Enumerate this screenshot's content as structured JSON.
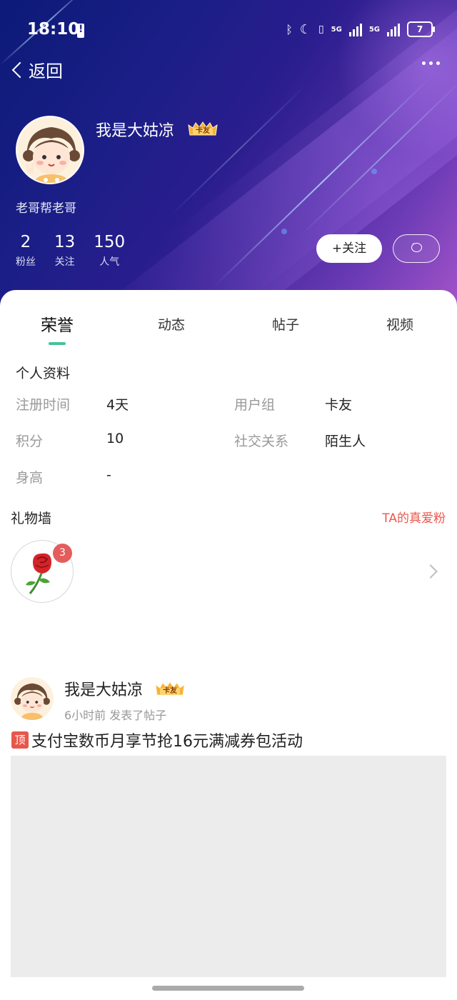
{
  "status_bar": {
    "time": "18:10",
    "network_1": "5G",
    "network_2": "5G",
    "battery": "7"
  },
  "nav": {
    "back_label": "返回"
  },
  "profile": {
    "username": "我是大姑凉",
    "badge_label": "卡友",
    "subtitle": "老哥帮老哥",
    "stats": [
      {
        "value": "2",
        "label": "粉丝"
      },
      {
        "value": "13",
        "label": "关注"
      },
      {
        "value": "150",
        "label": "人气"
      }
    ],
    "follow_label": "+关注"
  },
  "tabs": [
    {
      "label": "荣誉",
      "active": true
    },
    {
      "label": "动态",
      "active": false
    },
    {
      "label": "帖子",
      "active": false
    },
    {
      "label": "视频",
      "active": false
    }
  ],
  "personal_info": {
    "title": "个人资料",
    "rows": [
      {
        "k1": "注册时间",
        "v1": "4天",
        "k2": "用户组",
        "v2": "卡友"
      },
      {
        "k1": "积分",
        "v1": "10",
        "k2": "社交关系",
        "v2": "陌生人"
      },
      {
        "k1": "身高",
        "v1": "-"
      }
    ]
  },
  "gift_wall": {
    "title": "礼物墙",
    "fans_link": "TA的真爱粉",
    "gift_count": "3"
  },
  "post": {
    "author": "我是大姑凉",
    "badge_label": "卡友",
    "meta": "6小时前  发表了帖子",
    "top_tag": "顶",
    "title": "支付宝数币月享节抢16元满减券包活动"
  },
  "colors": {
    "accent_green": "#46c29a",
    "link_red": "#e9584e",
    "hero_start": "#0c1a78",
    "hero_end": "#a453c8"
  }
}
